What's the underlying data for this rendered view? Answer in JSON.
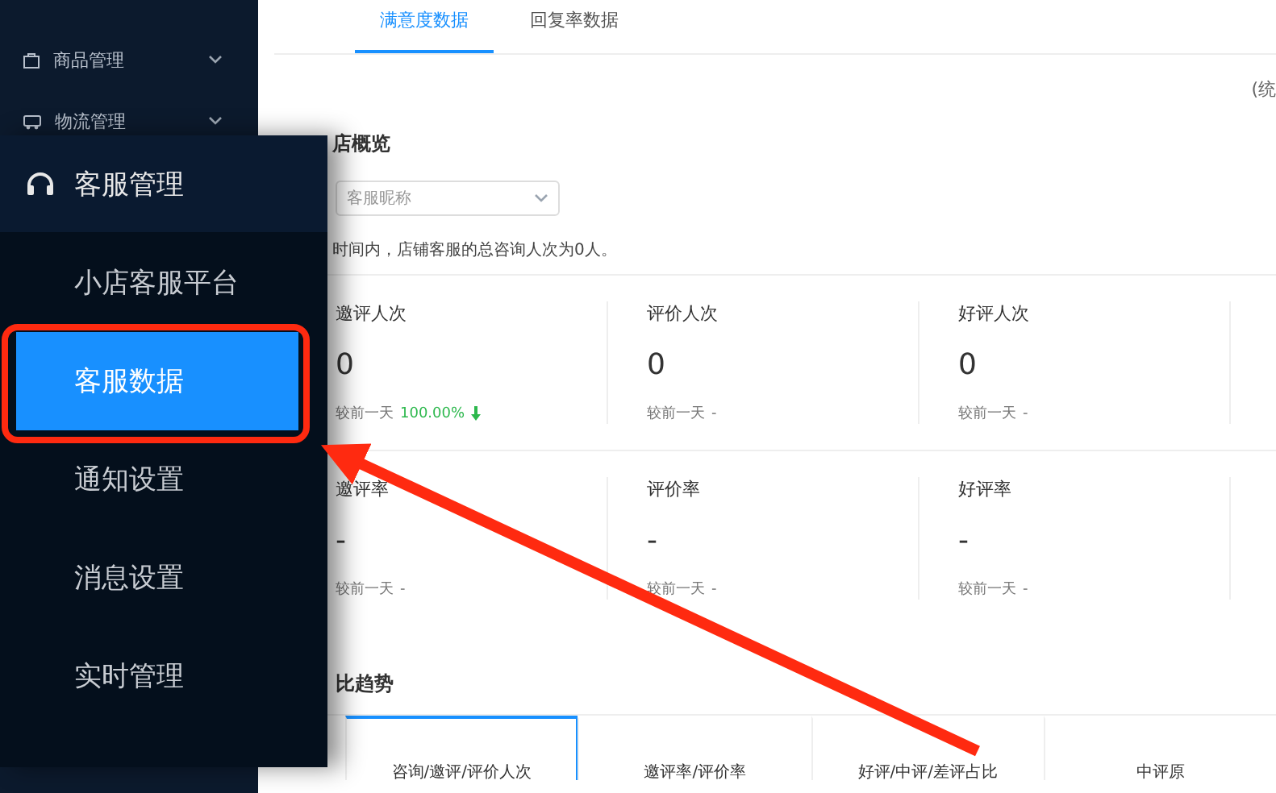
{
  "sidebar": {
    "items": [
      {
        "label": "商品管理"
      },
      {
        "label": "物流管理"
      }
    ]
  },
  "tabs": [
    {
      "label": "满意度数据",
      "selected": true
    },
    {
      "label": "回复率数据",
      "selected": false
    }
  ],
  "stat_note": "(统",
  "overview": {
    "title": "店概览",
    "select": {
      "placeholder": "客服昵称"
    },
    "summary": "时间内，店铺客服的总咨询人次为0人。"
  },
  "metrics": [
    [
      {
        "label": "邀评人次",
        "value": "0",
        "compare": "较前一天",
        "delta": "100.00%",
        "kind": "decrease"
      },
      {
        "label": "评价人次",
        "value": "0",
        "compare": "较前一天",
        "delta": "-",
        "kind": "plain"
      },
      {
        "label": "好评人次",
        "value": "0",
        "compare": "较前一天",
        "delta": "-",
        "kind": "plain"
      }
    ],
    [
      {
        "label": "邀评率",
        "value": "-",
        "compare": "较前一天",
        "delta": "-",
        "kind": "plain"
      },
      {
        "label": "评价率",
        "value": "-",
        "compare": "较前一天",
        "delta": "-",
        "kind": "plain"
      },
      {
        "label": "好评率",
        "value": "-",
        "compare": "较前一天",
        "delta": "-",
        "kind": "plain"
      }
    ]
  ],
  "trend": {
    "title": "比趋势",
    "tabs": [
      {
        "label": "咨询/邀评/评价人次",
        "selected": true
      },
      {
        "label": "邀评率/评价率",
        "selected": false
      },
      {
        "label": "好评/中评/差评占比",
        "selected": false
      },
      {
        "label": "中评原",
        "selected": false
      }
    ]
  },
  "zoom_popup": {
    "title": "客服管理",
    "items": [
      {
        "label": "小店客服平台",
        "selected": false
      },
      {
        "label": "客服数据",
        "selected": true
      },
      {
        "label": "通知设置",
        "selected": false
      },
      {
        "label": "消息设置",
        "selected": false
      },
      {
        "label": "实时管理",
        "selected": false
      }
    ]
  }
}
